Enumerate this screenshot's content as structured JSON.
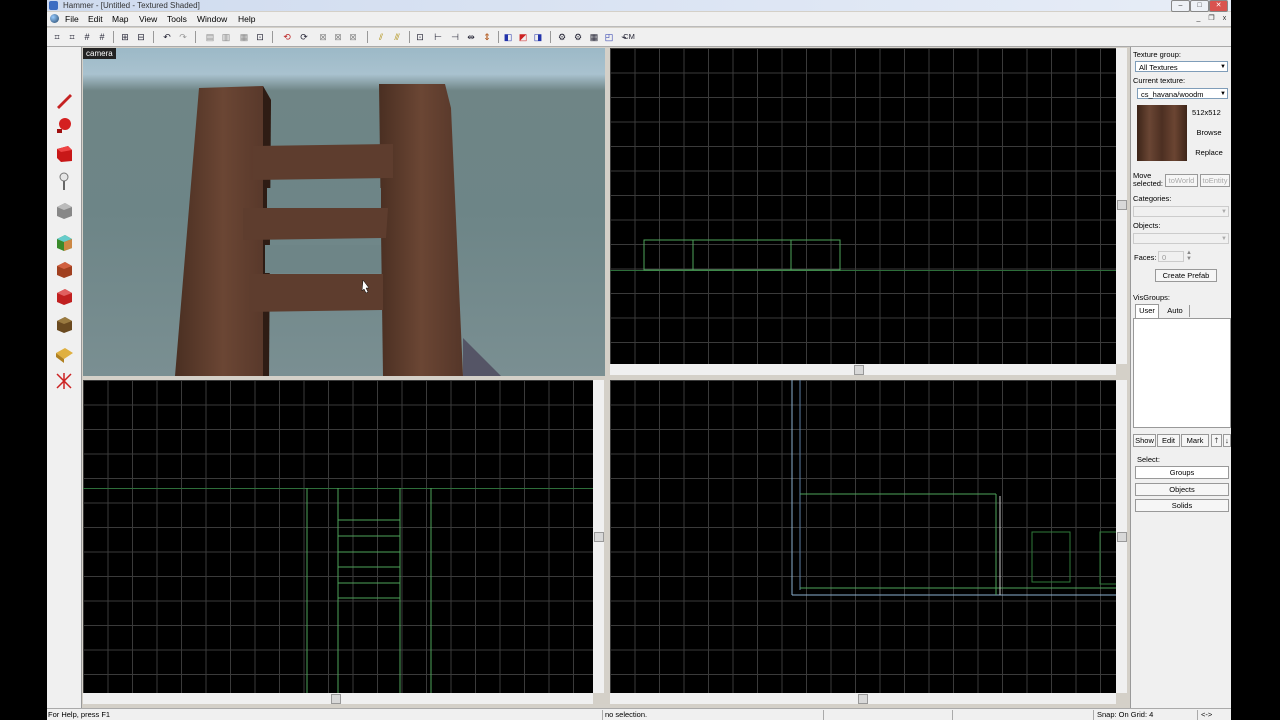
{
  "window": {
    "title": "Hammer - [Untitled - Textured Shaded]",
    "controls": {
      "minimize": "–",
      "maximize": "□",
      "close": "✕"
    },
    "mdi_controls": {
      "minimize": "_",
      "restore": "❐",
      "close": "x"
    }
  },
  "menu": [
    "File",
    "Edit",
    "Map",
    "View",
    "Tools",
    "Window",
    "Help"
  ],
  "toolbar": {
    "cm_label": "CM"
  },
  "camera_view": {
    "label": "camera"
  },
  "texture_panel": {
    "group_label": "Texture group:",
    "group_value": "All Textures",
    "current_label": "Current texture:",
    "current_value": "cs_havana/woodm",
    "size": "512x512",
    "browse": "Browse",
    "replace": "Replace"
  },
  "move_panel": {
    "label": "Move selected:",
    "to_world": "toWorld",
    "to_entity": "toEntity"
  },
  "categories_label": "Categories:",
  "objects_label": "Objects:",
  "faces": {
    "label": "Faces:",
    "value": "0"
  },
  "create_prefab": "Create Prefab",
  "visgroups": {
    "label": "VisGroups:",
    "tabs": [
      "User",
      "Auto"
    ]
  },
  "visgroup_buttons": [
    "Show",
    "Edit",
    "Mark"
  ],
  "select_panel": {
    "label": "Select:",
    "groups": "Groups",
    "objects": "Objects",
    "solids": "Solids"
  },
  "status_bar": {
    "help": "For Help, press F1",
    "selection": "no selection.",
    "snap": "Snap: On Grid: 4",
    "arrows": "<->"
  }
}
